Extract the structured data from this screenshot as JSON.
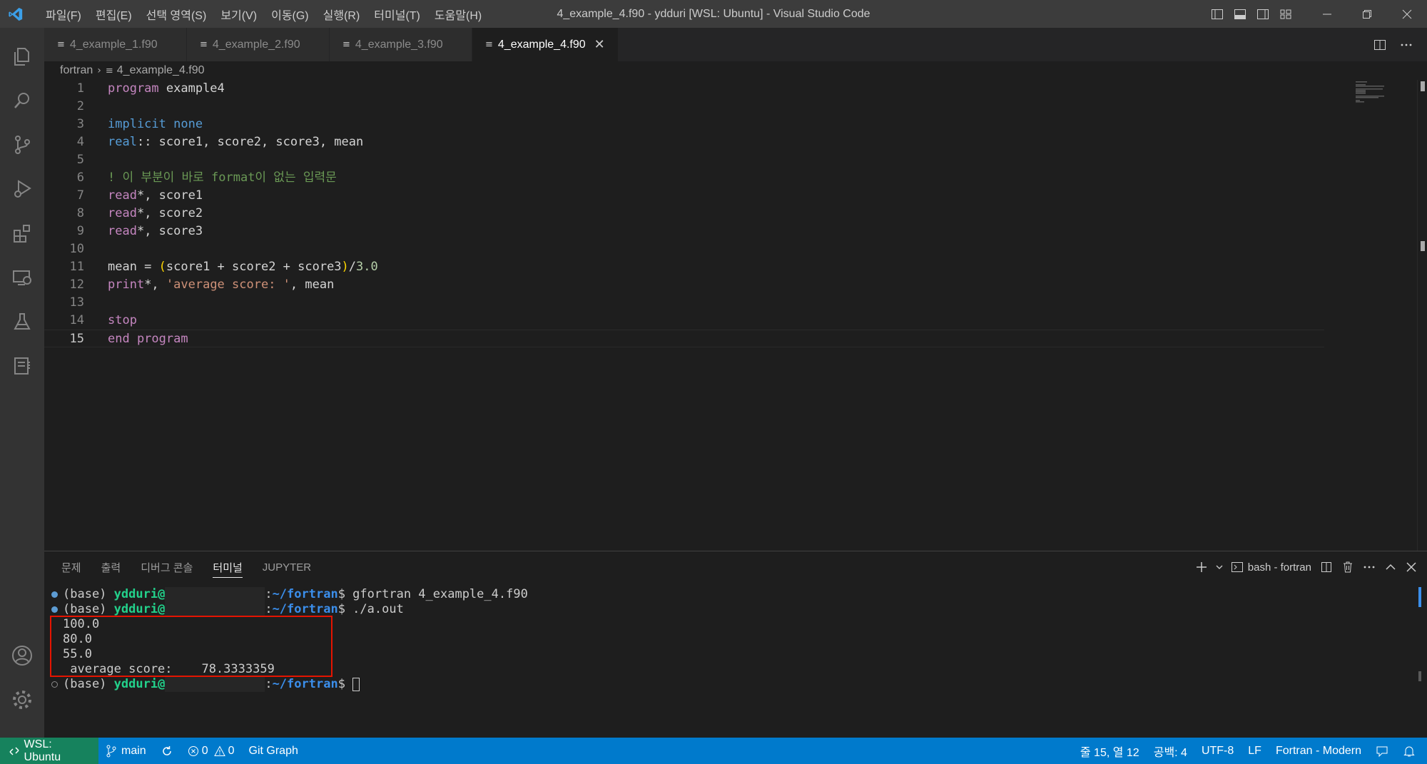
{
  "titlebar": {
    "menus": [
      "파일(F)",
      "편집(E)",
      "선택 영역(S)",
      "보기(V)",
      "이동(G)",
      "실행(R)",
      "터미널(T)",
      "도움말(H)"
    ],
    "title": "4_example_4.f90 - ydduri [WSL: Ubuntu] - Visual Studio Code"
  },
  "tabs": [
    {
      "label": "4_example_1.f90",
      "active": false
    },
    {
      "label": "4_example_2.f90",
      "active": false
    },
    {
      "label": "4_example_3.f90",
      "active": false
    },
    {
      "label": "4_example_4.f90",
      "active": true
    }
  ],
  "tab_close": "✕",
  "breadcrumb": {
    "folder": "fortran",
    "file": "4_example_4.f90"
  },
  "editor": {
    "lines": [
      {
        "n": "1",
        "code": "program example4"
      },
      {
        "n": "2",
        "code": ""
      },
      {
        "n": "3",
        "code": "implicit none"
      },
      {
        "n": "4",
        "code": "real:: score1, score2, score3, mean"
      },
      {
        "n": "5",
        "code": ""
      },
      {
        "n": "6",
        "code": "! 이 부분이 바로 format이 없는 입력문"
      },
      {
        "n": "7",
        "code": "read*, score1"
      },
      {
        "n": "8",
        "code": "read*, score2"
      },
      {
        "n": "9",
        "code": "read*, score3"
      },
      {
        "n": "10",
        "code": ""
      },
      {
        "n": "11",
        "code": "mean = (score1 + score2 + score3)/3.0"
      },
      {
        "n": "12",
        "code": "print*, 'average score: ', mean"
      },
      {
        "n": "13",
        "code": ""
      },
      {
        "n": "14",
        "code": "stop"
      },
      {
        "n": "15",
        "code": "end program"
      }
    ]
  },
  "panel": {
    "tabs": [
      "문제",
      "출력",
      "디버그 콘솔",
      "터미널",
      "JUPYTER"
    ],
    "active_tab": "터미널",
    "terminal_name": "bash - fortran"
  },
  "terminal": {
    "prompt_base": "(base) ",
    "user": "ydduri@",
    "path_prefix": ":",
    "path": "~/fortran",
    "dollar": "$ ",
    "cmd1": "gfortran 4_example_4.f90",
    "cmd2": "./a.out",
    "output": [
      "100.0",
      "80.0",
      "55.0",
      " average score:    78.3333359"
    ]
  },
  "statusbar": {
    "remote": "WSL: Ubuntu",
    "branch": "main",
    "errors": "0",
    "warnings": "0",
    "git_graph": "Git Graph",
    "position": "줄 15, 열 12",
    "spaces": "공백: 4",
    "encoding": "UTF-8",
    "eol": "LF",
    "language": "Fortran - Modern"
  },
  "colors": {
    "accent": "#007acc",
    "remote": "#16825d",
    "highlight_box": "#e51400"
  },
  "icons": [
    "vscode-logo-icon",
    "explorer-icon",
    "search-icon",
    "source-control-icon",
    "run-debug-icon",
    "extensions-icon",
    "remote-explorer-icon",
    "testing-icon",
    "jupyter-icon",
    "accounts-icon",
    "manage-gear-icon"
  ]
}
